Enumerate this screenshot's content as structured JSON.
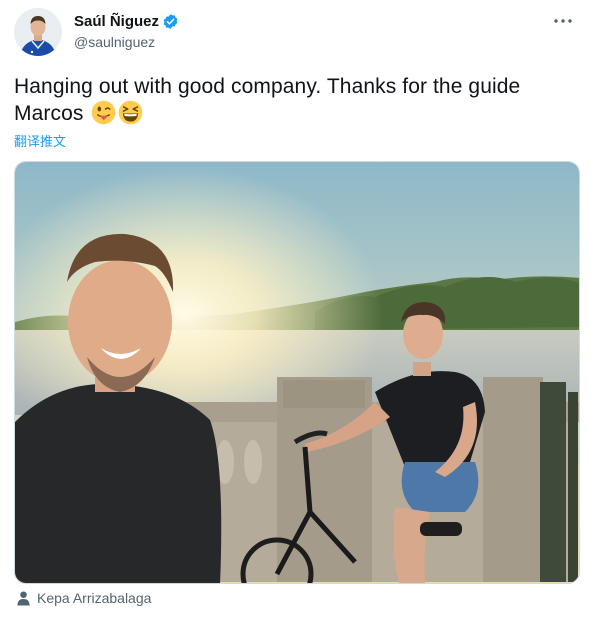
{
  "author": {
    "display_name": "Saúl Ñiguez",
    "handle": "@saulniguez",
    "verified": true,
    "avatar_icon": "avatar-photo"
  },
  "tweet": {
    "text": "Hanging out with good company. Thanks for the guide Marcos",
    "emojis": [
      "tongue-out-emoji",
      "grinning-squinting-emoji"
    ],
    "translate_label": "翻译推文"
  },
  "media": {
    "description_icon": "selfie-photo"
  },
  "tagged": {
    "icon": "person-icon",
    "name": "Kepa Arrizabalaga"
  },
  "colors": {
    "accent": "#1d9bf0",
    "secondary_text": "#536471",
    "primary_text": "#0f1419"
  }
}
